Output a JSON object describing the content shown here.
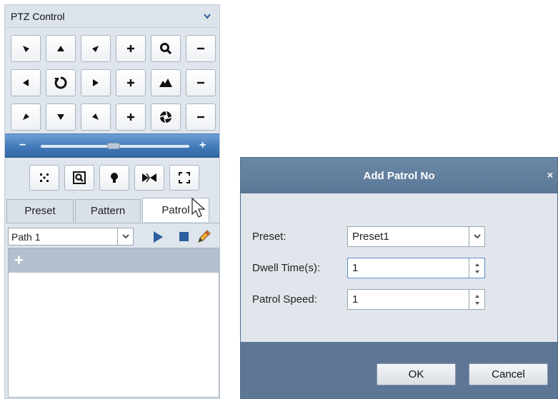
{
  "ptz": {
    "title": "PTZ Control",
    "speed": {
      "minus": "−",
      "plus": "+"
    },
    "tabs": [
      {
        "label": "Preset"
      },
      {
        "label": "Pattern"
      },
      {
        "label": "Patrol"
      }
    ],
    "path_select": {
      "value": "Path 1"
    },
    "list_add": "+"
  },
  "dialog": {
    "title": "Add Patrol No",
    "close": "×",
    "preset_label": "Preset:",
    "preset_value": "Preset1",
    "dwell_label": "Dwell Time(s):",
    "dwell_value": "1",
    "speed_label": "Patrol Speed:",
    "speed_value": "1",
    "ok_label": "OK",
    "cancel_label": "Cancel"
  },
  "colors": {
    "speed_bar": "#3f77b8",
    "dialog_header": "#5c7897",
    "list_header": "#b2bfcc",
    "play_icon": "#2b5f9e"
  }
}
